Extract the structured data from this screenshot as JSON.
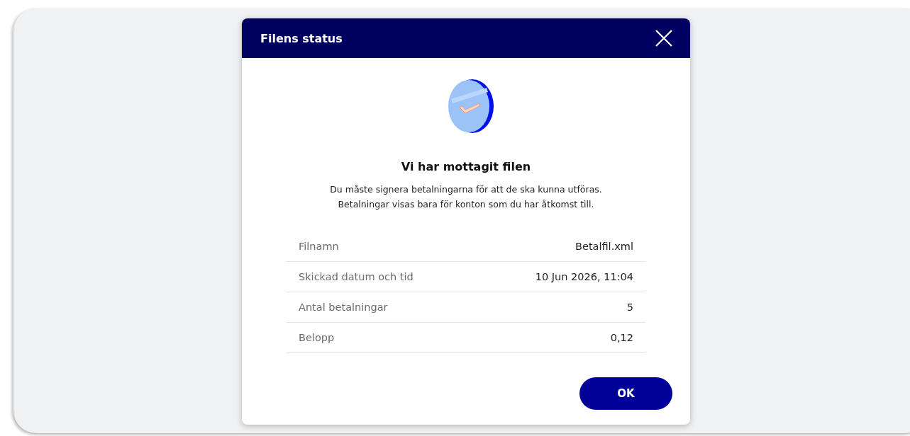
{
  "dialog": {
    "title": "Filens status",
    "heading": "Vi har mottagit filen",
    "message_lines": [
      "Du måste signera betalningarna för att de ska kunna utföras.",
      "Betalningar visas bara för konton som du har åtkomst till."
    ],
    "details": [
      {
        "label": "Filnamn",
        "value": "Betalfil.xml"
      },
      {
        "label": "Skickad datum och tid",
        "value": "10 Jun 2026, 11:04"
      },
      {
        "label": "Antal betalningar",
        "value": "5"
      },
      {
        "label": "Belopp",
        "value": "0,12"
      }
    ],
    "button": "OK"
  }
}
